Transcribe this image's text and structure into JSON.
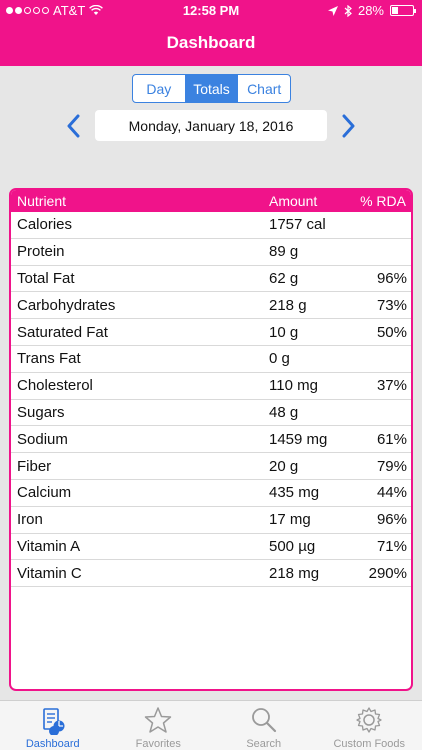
{
  "status": {
    "carrier": "AT&T",
    "time": "12:58 PM",
    "battery": "28%"
  },
  "nav": {
    "title": "Dashboard"
  },
  "segmented": {
    "options": [
      "Day",
      "Totals",
      "Chart"
    ],
    "selected": "Totals"
  },
  "date": {
    "label": "Monday, January 18, 2016"
  },
  "table": {
    "headers": [
      "Nutrient",
      "Amount",
      "% RDA"
    ],
    "rows": [
      {
        "nutrient": "Calories",
        "amount": "1757 cal",
        "rda": ""
      },
      {
        "nutrient": "Protein",
        "amount": "89 g",
        "rda": ""
      },
      {
        "nutrient": "Total Fat",
        "amount": "62 g",
        "rda": "96%"
      },
      {
        "nutrient": "Carbohydrates",
        "amount": "218 g",
        "rda": "73%"
      },
      {
        "nutrient": "Saturated Fat",
        "amount": "10 g",
        "rda": "50%"
      },
      {
        "nutrient": "Trans Fat",
        "amount": "0 g",
        "rda": ""
      },
      {
        "nutrient": "Cholesterol",
        "amount": "110 mg",
        "rda": "37%"
      },
      {
        "nutrient": "Sugars",
        "amount": "48 g",
        "rda": ""
      },
      {
        "nutrient": "Sodium",
        "amount": "1459 mg",
        "rda": "61%"
      },
      {
        "nutrient": "Fiber",
        "amount": "20 g",
        "rda": "79%"
      },
      {
        "nutrient": "Calcium",
        "amount": "435 mg",
        "rda": "44%"
      },
      {
        "nutrient": "Iron",
        "amount": "17 mg",
        "rda": "96%"
      },
      {
        "nutrient": "Vitamin A",
        "amount": "500 µg",
        "rda": "71%"
      },
      {
        "nutrient": "Vitamin C",
        "amount": "218 mg",
        "rda": "290%"
      }
    ]
  },
  "tabs": [
    {
      "label": "Dashboard",
      "icon": "dashboard-icon",
      "active": true
    },
    {
      "label": "Favorites",
      "icon": "star-icon",
      "active": false
    },
    {
      "label": "Search",
      "icon": "search-icon",
      "active": false
    },
    {
      "label": "Custom Foods",
      "icon": "gear-icon",
      "active": false
    }
  ],
  "colors": {
    "brand": "#f0138a",
    "accent": "#3b82e0"
  }
}
